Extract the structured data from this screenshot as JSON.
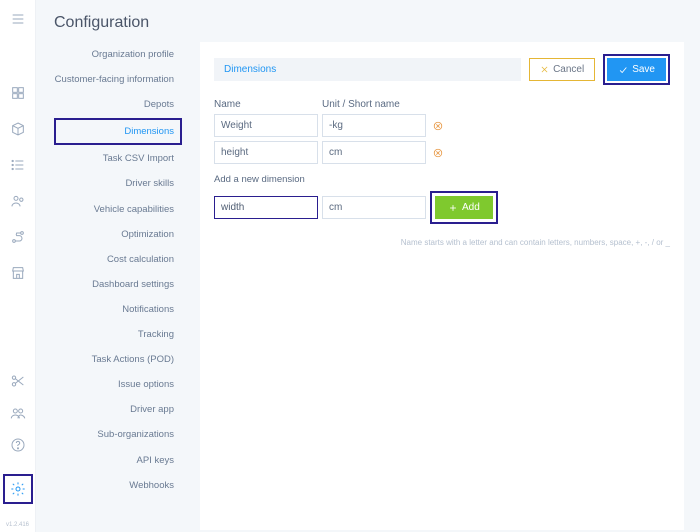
{
  "page": {
    "title": "Configuration",
    "version": "v1.2.416"
  },
  "railIcons": {
    "top": [
      "menu",
      "dashboard",
      "box",
      "list",
      "team",
      "route",
      "store"
    ],
    "bottom": [
      "scissors",
      "group",
      "help",
      "gear"
    ]
  },
  "settingsNav": {
    "items": [
      "Organization profile",
      "Customer-facing information",
      "Depots",
      "Dimensions",
      "Task CSV Import",
      "Driver skills",
      "Vehicle capabilities",
      "Optimization",
      "Cost calculation",
      "Dashboard settings",
      "Notifications",
      "Tracking",
      "Task Actions (POD)",
      "Issue options",
      "Driver app",
      "Sub-organizations",
      "API keys",
      "Webhooks"
    ],
    "activeIndex": 3
  },
  "crumb": "Dimensions",
  "buttons": {
    "cancel": "Cancel",
    "save": "Save",
    "add": "Add"
  },
  "table": {
    "headers": {
      "name": "Name",
      "unit": "Unit / Short name"
    },
    "rows": [
      {
        "name": "Weight",
        "unit": "-kg"
      },
      {
        "name": "height",
        "unit": "cm"
      }
    ]
  },
  "addNew": {
    "label": "Add a new dimension",
    "name": "width",
    "unit": "cm"
  },
  "hint": "Name starts with a letter and can contain letters, numbers, space, +, -, / or _"
}
